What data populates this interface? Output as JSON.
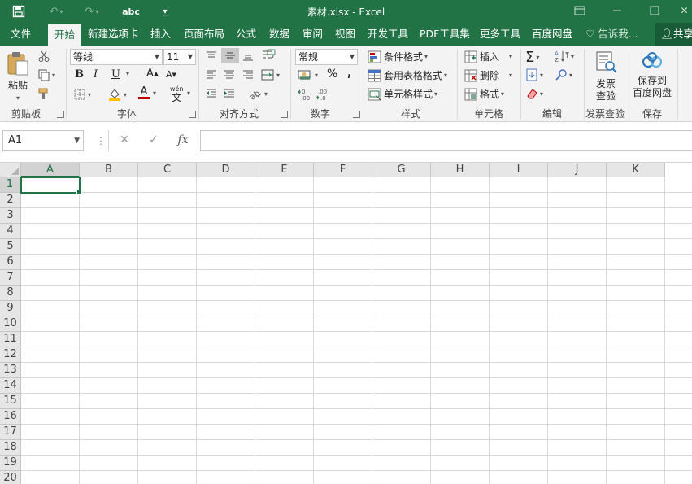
{
  "window": {
    "title": "素材.xlsx - Excel"
  },
  "quick_access": {
    "spelling_label": "abc"
  },
  "tabs": [
    "文件",
    "开始",
    "新建选项卡",
    "插入",
    "页面布局",
    "公式",
    "数据",
    "审阅",
    "视图",
    "开发工具",
    "PDF工具集",
    "更多工具",
    "百度网盘"
  ],
  "active_tab": "开始",
  "tell_me": "告诉我...",
  "share": "共享",
  "ribbon": {
    "clipboard": {
      "label": "剪贴板",
      "paste": "粘贴"
    },
    "font": {
      "label": "字体",
      "name": "等线",
      "size": "11",
      "bold": "B",
      "italic": "I",
      "underline": "U",
      "grow": "A",
      "shrink": "A",
      "color_letter": "A",
      "phonetic": "wén"
    },
    "alignment": {
      "label": "对齐方式"
    },
    "number": {
      "label": "数字",
      "format": "常规",
      "percent": "%",
      "comma": ","
    },
    "styles": {
      "label": "样式",
      "conditional": "条件格式",
      "table": "套用表格格式",
      "cell": "单元格样式"
    },
    "cells": {
      "label": "单元格",
      "insert": "插入",
      "delete": "删除",
      "format": "格式"
    },
    "editing": {
      "label": "编辑"
    },
    "invoice": {
      "label": "发票查验",
      "button": "发票\n查验"
    },
    "save": {
      "label": "保存",
      "button": "保存到\n百度网盘"
    }
  },
  "formula_bar": {
    "name_box": "A1",
    "fx": "fx",
    "value": ""
  },
  "columns": [
    "A",
    "B",
    "C",
    "D",
    "E",
    "F",
    "G",
    "H",
    "I",
    "J",
    "K"
  ],
  "rows": [
    "1",
    "2",
    "3",
    "4",
    "5",
    "6",
    "7",
    "8",
    "9",
    "10",
    "11",
    "12",
    "13",
    "14",
    "15",
    "16",
    "17",
    "18",
    "19",
    "20"
  ],
  "colors": {
    "accent": "#217346",
    "ribbon": "#f3f3f3",
    "header": "#e6e6e6"
  }
}
